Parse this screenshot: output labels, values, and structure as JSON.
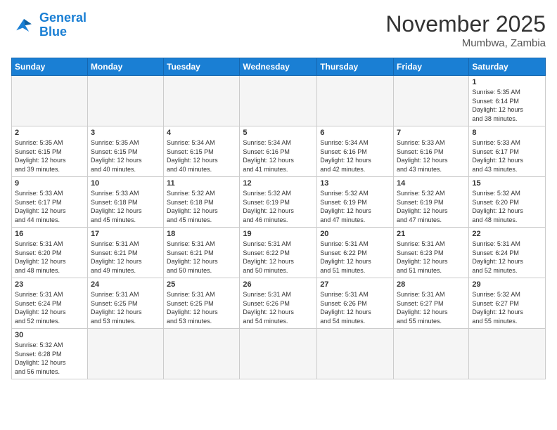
{
  "header": {
    "logo_general": "General",
    "logo_blue": "Blue",
    "month_title": "November 2025",
    "location": "Mumbwa, Zambia"
  },
  "weekdays": [
    "Sunday",
    "Monday",
    "Tuesday",
    "Wednesday",
    "Thursday",
    "Friday",
    "Saturday"
  ],
  "weeks": [
    [
      {
        "day": "",
        "info": ""
      },
      {
        "day": "",
        "info": ""
      },
      {
        "day": "",
        "info": ""
      },
      {
        "day": "",
        "info": ""
      },
      {
        "day": "",
        "info": ""
      },
      {
        "day": "",
        "info": ""
      },
      {
        "day": "1",
        "info": "Sunrise: 5:35 AM\nSunset: 6:14 PM\nDaylight: 12 hours\nand 38 minutes."
      }
    ],
    [
      {
        "day": "2",
        "info": "Sunrise: 5:35 AM\nSunset: 6:15 PM\nDaylight: 12 hours\nand 39 minutes."
      },
      {
        "day": "3",
        "info": "Sunrise: 5:35 AM\nSunset: 6:15 PM\nDaylight: 12 hours\nand 40 minutes."
      },
      {
        "day": "4",
        "info": "Sunrise: 5:34 AM\nSunset: 6:15 PM\nDaylight: 12 hours\nand 40 minutes."
      },
      {
        "day": "5",
        "info": "Sunrise: 5:34 AM\nSunset: 6:16 PM\nDaylight: 12 hours\nand 41 minutes."
      },
      {
        "day": "6",
        "info": "Sunrise: 5:34 AM\nSunset: 6:16 PM\nDaylight: 12 hours\nand 42 minutes."
      },
      {
        "day": "7",
        "info": "Sunrise: 5:33 AM\nSunset: 6:16 PM\nDaylight: 12 hours\nand 43 minutes."
      },
      {
        "day": "8",
        "info": "Sunrise: 5:33 AM\nSunset: 6:17 PM\nDaylight: 12 hours\nand 43 minutes."
      }
    ],
    [
      {
        "day": "9",
        "info": "Sunrise: 5:33 AM\nSunset: 6:17 PM\nDaylight: 12 hours\nand 44 minutes."
      },
      {
        "day": "10",
        "info": "Sunrise: 5:33 AM\nSunset: 6:18 PM\nDaylight: 12 hours\nand 45 minutes."
      },
      {
        "day": "11",
        "info": "Sunrise: 5:32 AM\nSunset: 6:18 PM\nDaylight: 12 hours\nand 45 minutes."
      },
      {
        "day": "12",
        "info": "Sunrise: 5:32 AM\nSunset: 6:19 PM\nDaylight: 12 hours\nand 46 minutes."
      },
      {
        "day": "13",
        "info": "Sunrise: 5:32 AM\nSunset: 6:19 PM\nDaylight: 12 hours\nand 47 minutes."
      },
      {
        "day": "14",
        "info": "Sunrise: 5:32 AM\nSunset: 6:19 PM\nDaylight: 12 hours\nand 47 minutes."
      },
      {
        "day": "15",
        "info": "Sunrise: 5:32 AM\nSunset: 6:20 PM\nDaylight: 12 hours\nand 48 minutes."
      }
    ],
    [
      {
        "day": "16",
        "info": "Sunrise: 5:31 AM\nSunset: 6:20 PM\nDaylight: 12 hours\nand 48 minutes."
      },
      {
        "day": "17",
        "info": "Sunrise: 5:31 AM\nSunset: 6:21 PM\nDaylight: 12 hours\nand 49 minutes."
      },
      {
        "day": "18",
        "info": "Sunrise: 5:31 AM\nSunset: 6:21 PM\nDaylight: 12 hours\nand 50 minutes."
      },
      {
        "day": "19",
        "info": "Sunrise: 5:31 AM\nSunset: 6:22 PM\nDaylight: 12 hours\nand 50 minutes."
      },
      {
        "day": "20",
        "info": "Sunrise: 5:31 AM\nSunset: 6:22 PM\nDaylight: 12 hours\nand 51 minutes."
      },
      {
        "day": "21",
        "info": "Sunrise: 5:31 AM\nSunset: 6:23 PM\nDaylight: 12 hours\nand 51 minutes."
      },
      {
        "day": "22",
        "info": "Sunrise: 5:31 AM\nSunset: 6:24 PM\nDaylight: 12 hours\nand 52 minutes."
      }
    ],
    [
      {
        "day": "23",
        "info": "Sunrise: 5:31 AM\nSunset: 6:24 PM\nDaylight: 12 hours\nand 52 minutes."
      },
      {
        "day": "24",
        "info": "Sunrise: 5:31 AM\nSunset: 6:25 PM\nDaylight: 12 hours\nand 53 minutes."
      },
      {
        "day": "25",
        "info": "Sunrise: 5:31 AM\nSunset: 6:25 PM\nDaylight: 12 hours\nand 53 minutes."
      },
      {
        "day": "26",
        "info": "Sunrise: 5:31 AM\nSunset: 6:26 PM\nDaylight: 12 hours\nand 54 minutes."
      },
      {
        "day": "27",
        "info": "Sunrise: 5:31 AM\nSunset: 6:26 PM\nDaylight: 12 hours\nand 54 minutes."
      },
      {
        "day": "28",
        "info": "Sunrise: 5:31 AM\nSunset: 6:27 PM\nDaylight: 12 hours\nand 55 minutes."
      },
      {
        "day": "29",
        "info": "Sunrise: 5:32 AM\nSunset: 6:27 PM\nDaylight: 12 hours\nand 55 minutes."
      }
    ],
    [
      {
        "day": "30",
        "info": "Sunrise: 5:32 AM\nSunset: 6:28 PM\nDaylight: 12 hours\nand 56 minutes."
      },
      {
        "day": "",
        "info": ""
      },
      {
        "day": "",
        "info": ""
      },
      {
        "day": "",
        "info": ""
      },
      {
        "day": "",
        "info": ""
      },
      {
        "day": "",
        "info": ""
      },
      {
        "day": "",
        "info": ""
      }
    ]
  ]
}
